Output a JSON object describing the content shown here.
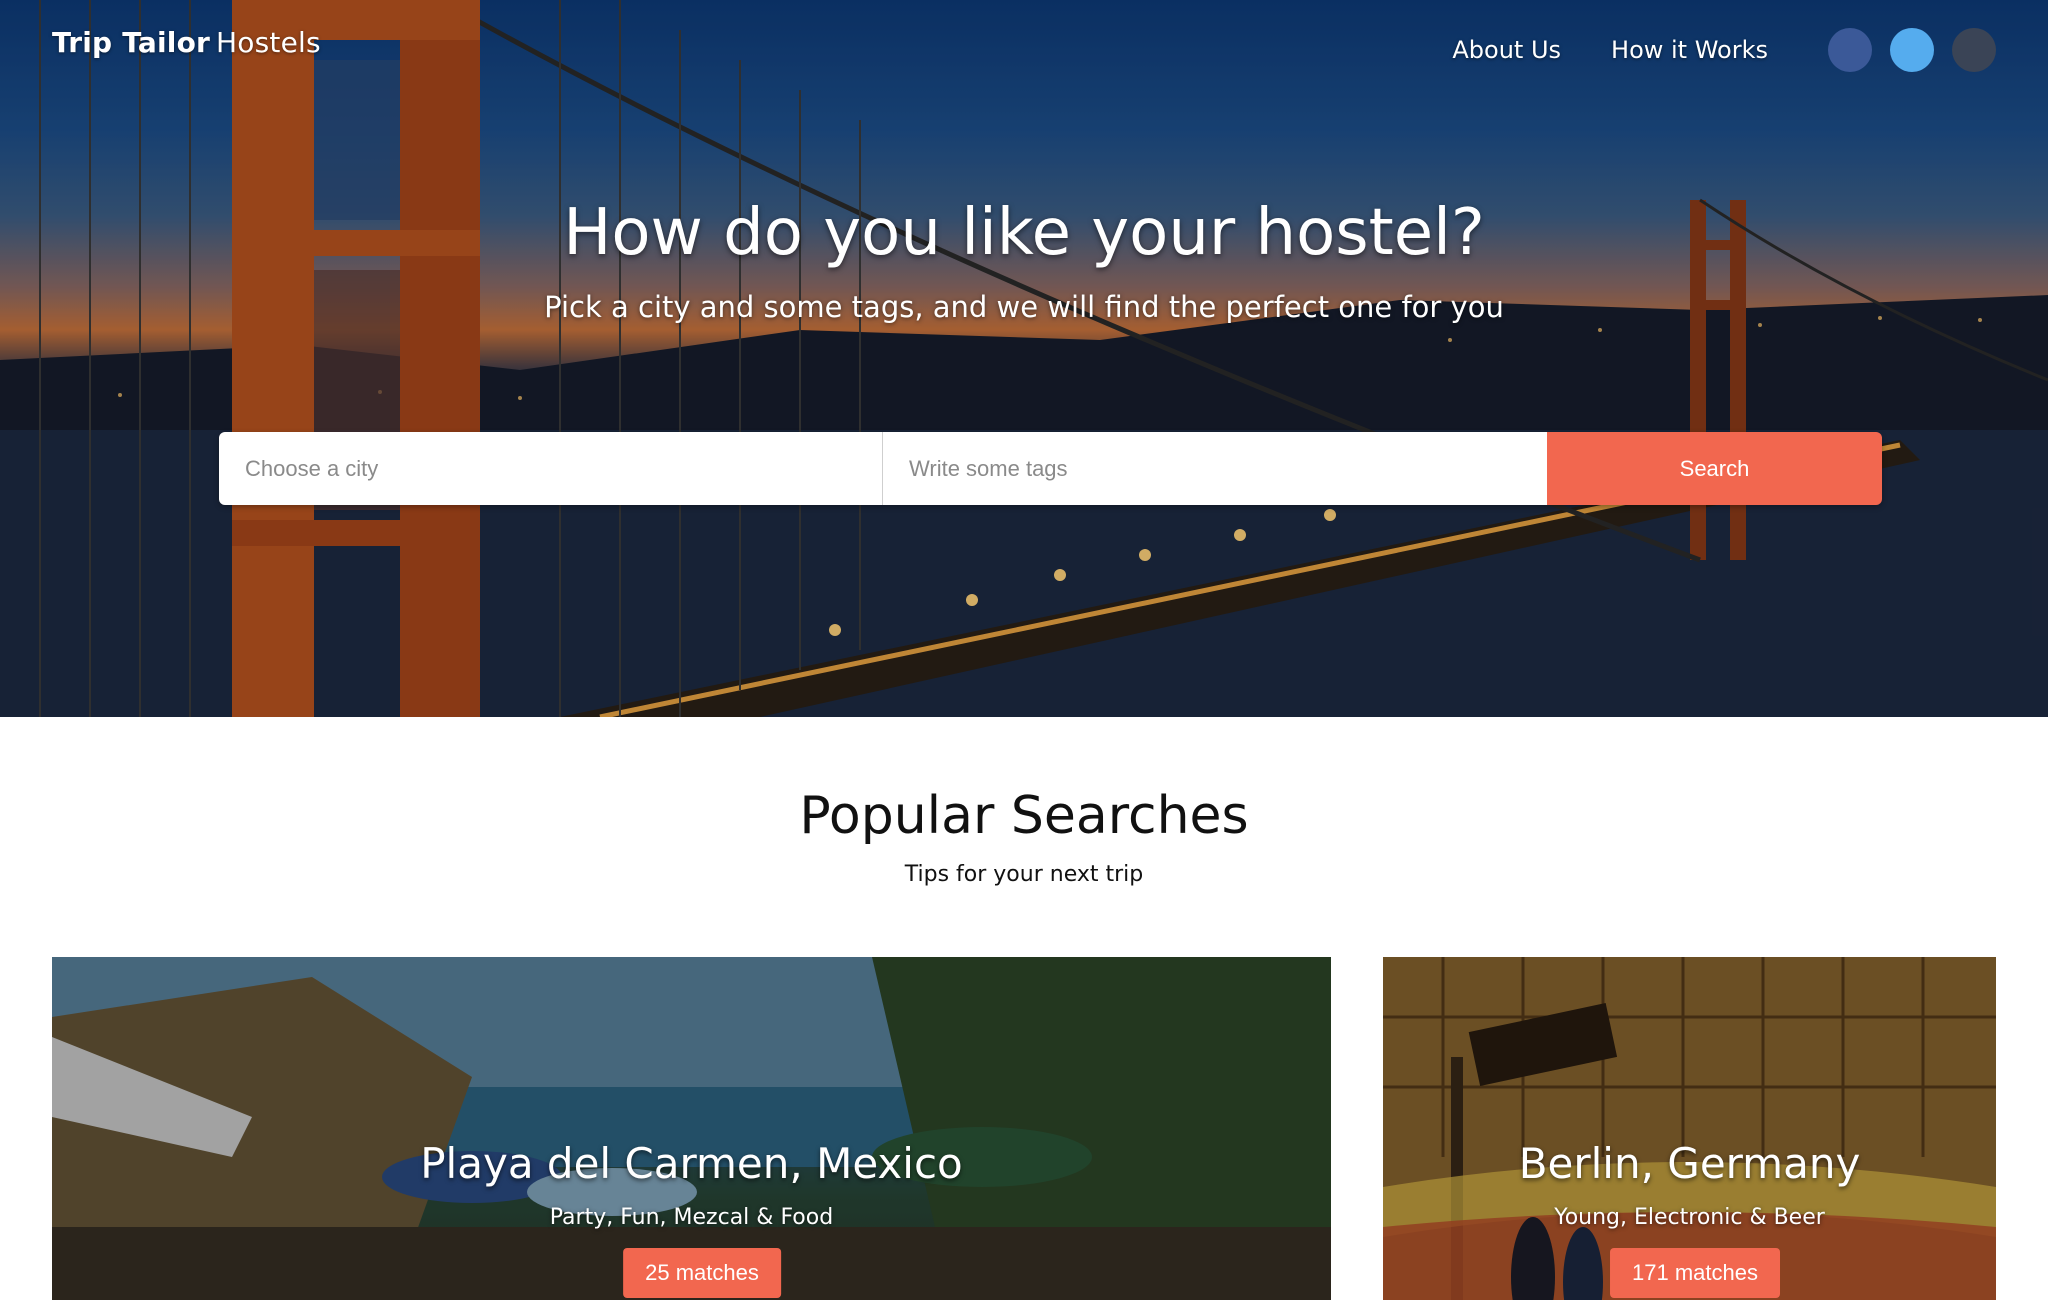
{
  "header": {
    "brand_bold": "Trip Tailor",
    "brand_regular": "Hostels",
    "nav": {
      "about_label": "About Us",
      "how_label": "How it Works"
    },
    "social_icons": [
      {
        "name": "facebook-icon",
        "color": "#3b5998"
      },
      {
        "name": "twitter-icon",
        "color": "#55acee"
      },
      {
        "name": "github-icon",
        "color": "#3a4456"
      }
    ]
  },
  "hero": {
    "title": "How do you like your hostel?",
    "subtitle": "Pick a city and some tags, and we will find the perfect one for you",
    "search": {
      "city_placeholder": "Choose a city",
      "city_value": "",
      "tags_placeholder": "Write some tags",
      "tags_value": "",
      "button_label": "Search"
    }
  },
  "popular": {
    "title": "Popular Searches",
    "subtitle": "Tips for your next trip",
    "cards": [
      {
        "city": "Playa del Carmen, Mexico",
        "tags": "Party, Fun, Mezcal & Food",
        "matches": "25 matches"
      },
      {
        "city": "Berlin, Germany",
        "tags": "Young, Electronic & Beer",
        "matches": "171 matches"
      }
    ]
  },
  "colors": {
    "accent": "#f2674f",
    "text_dark": "#111111",
    "white": "#ffffff"
  }
}
